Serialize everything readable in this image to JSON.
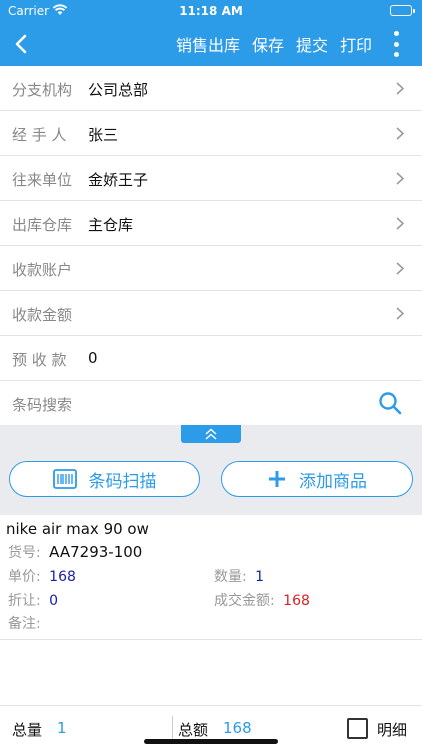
{
  "status_bar": {
    "carrier": "Carrier",
    "time": "11:18 AM"
  },
  "nav": {
    "title": "销售出库",
    "save_label": "保存",
    "submit_label": "提交",
    "print_label": "打印"
  },
  "form": {
    "rows": [
      {
        "label": "分支机构",
        "value": "公司总部"
      },
      {
        "label": "经 手 人",
        "value": "张三"
      },
      {
        "label": "往来单位",
        "value": "金娇王子"
      },
      {
        "label": "出库仓库",
        "value": "主仓库"
      },
      {
        "label": "收款账户",
        "value": ""
      },
      {
        "label": "收款金额",
        "value": ""
      },
      {
        "label": "预 收 款",
        "value": "0"
      }
    ],
    "search_placeholder": "条码搜索"
  },
  "tools": {
    "scan_label": "条码扫描",
    "add_label": "添加商品"
  },
  "item": {
    "name": "nike air max 90 ow",
    "sku_label": "货号:",
    "sku": "AA7293-100",
    "price_label": "单价:",
    "price": "168",
    "qty_label": "数量:",
    "qty": "1",
    "discount_label": "折让:",
    "discount": "0",
    "deal_amount_label": "成交金额:",
    "deal_amount": "168",
    "note_label": "备注:"
  },
  "footer": {
    "total_qty_label": "总量",
    "total_qty": "1",
    "total_amount_label": "总额",
    "total_amount": "168",
    "detail_label": "明细",
    "detail_checked": false
  },
  "colors": {
    "accent": "#2c9be8",
    "blue_value": "#1a22a8",
    "red_value": "#d8222a"
  },
  "icons": [
    "wifi-icon",
    "battery-icon",
    "back-arrow-icon",
    "more-vertical-icon",
    "chevron-right-icon",
    "search-icon",
    "double-chevron-up-icon",
    "barcode-icon",
    "plus-icon",
    "checkbox-icon"
  ]
}
